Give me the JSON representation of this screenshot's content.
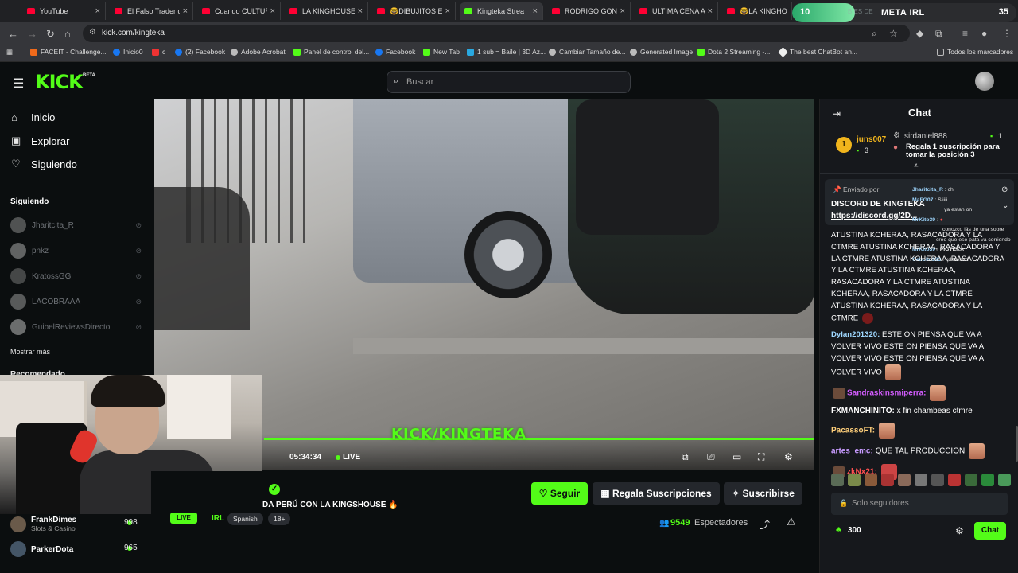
{
  "browser": {
    "tabs": [
      {
        "label": "YouTube",
        "icon": "youtube-icon"
      },
      {
        "label": "El Falso Trader qu",
        "icon": "youtube-icon"
      },
      {
        "label": "Cuando CULTUR",
        "icon": "youtube-icon"
      },
      {
        "label": "LA KINGHOUSE T",
        "icon": "youtube-icon"
      },
      {
        "label": "🤓DIBUJITOS ENT",
        "icon": "youtube-icon"
      },
      {
        "label": "Kingteka Strea",
        "icon": "kick-icon"
      },
      {
        "label": "RODRIGO GONZÁ",
        "icon": "youtube-icon"
      },
      {
        "label": "ULTIMA CENA AN",
        "icon": "youtube-icon"
      },
      {
        "label": "🤓LA KINGHOUS",
        "icon": "youtube-icon"
      }
    ],
    "meta_widget": {
      "left_value": "10",
      "title": "META IRL",
      "right_value": "35",
      "progress": 0.28,
      "bg_text": "BIES DE"
    },
    "url": "kick.com/kingteka",
    "bookmarks": [
      "FACEIT - Challenge...",
      "Inicio0",
      "c",
      "(2) Facebook",
      "Adobe Acrobat",
      "Panel de control del...",
      "Facebook",
      "New Tab",
      "1 sub = Baile | 3D Az...",
      "Cambiar Tamaño de...",
      "Generated Image",
      "Dota 2 Streaming -...",
      "The best ChatBot an..."
    ],
    "bookmarks_all": "Todos los marcadores"
  },
  "kick": {
    "logo": "KICK",
    "beta": "BETA",
    "search_placeholder": "Buscar"
  },
  "sidebar": {
    "nav": [
      {
        "label": "Inicio",
        "icon": "home-icon"
      },
      {
        "label": "Explorar",
        "icon": "explore-icon"
      },
      {
        "label": "Siguiendo",
        "icon": "heart-icon"
      }
    ],
    "heading": "Siguiendo",
    "following": [
      "Jharitcita_R",
      "pnkz",
      "KratossGG",
      "LACOBRAAA",
      "GuibelReviewsDirecto"
    ],
    "show_more": "Mostrar más",
    "recommended": "Recomendado",
    "recommended_items": [
      {
        "name": "FrankDimes",
        "category": "Slots & Casino",
        "viewers": "998"
      },
      {
        "name": "ParkerDota",
        "viewers": "965"
      }
    ]
  },
  "player": {
    "watermark": "KICK/KINGTEKA",
    "time": "05:34:34",
    "live": "LIVE"
  },
  "stream": {
    "title_visible": "DA PERÚ CON LA KINGSHOUSE 🔥",
    "live_badge": "LIVE",
    "category": "IRL",
    "tags": [
      "Spanish",
      "18+"
    ],
    "follow_label": "Seguir",
    "gift_label": "Regala Suscripciones",
    "subscribe_label": "Suscribirse",
    "viewers_count": "9549",
    "viewers_label": "Espectadores"
  },
  "chat": {
    "title": "Chat",
    "leaderboard": {
      "rank": "1",
      "top_user": "juns007",
      "top_count": "3",
      "second_user": "sirdaniel888",
      "second_count": "1",
      "promo": "Regala 1 suscripción para tomar la posición 3"
    },
    "pinned": {
      "by": "Enviado por",
      "title": "DISCORD DE KINGTEKA",
      "link": "https://discord.gg/2D..."
    },
    "overlay_lines": [
      {
        "user": "Jharitcita_R",
        "text": "chi"
      },
      {
        "user": "MaFG07",
        "text": "Siiiii"
      },
      {
        "user": "",
        "text": "ya estan on"
      },
      {
        "user": "MrKito39",
        "text": ""
      },
      {
        "user": "",
        "text": "conozco lás de una sobre"
      },
      {
        "user": "",
        "text": "creo que ese pata va corriendo"
      },
      {
        "user": "MrKito39",
        "text": "PIGTEKA"
      },
      {
        "user": "Cebollo123",
        "text": "xdxdxdxd"
      }
    ],
    "messages": [
      {
        "user": "",
        "text": "ATUSTINA KCHERAA, RASACADORA Y LA CTMRE ATUSTINA KCHERAA, RASACADORA Y LA CTMRE ATUSTINA KCHERAA, RASACADORA Y LA CTMRE ATUSTINA KCHERAA, RASACADORA Y LA CTMRE ATUSTINA KCHERAA, RASACADORA Y LA CTMRE ATUSTINA KCHERAA, RASACADORA Y LA CTMRE",
        "color": "#ffffff"
      },
      {
        "user": "Dylan201320:",
        "text": "ESTE ON PIENSA QUE VA A VOLVER VIVO ESTE ON PIENSA QUE VA A VOLVER VIVO ESTE ON PIENSA QUE VA A VOLVER VIVO",
        "color": "#9fd7ff"
      },
      {
        "user": "Sandraskinsmiperra:",
        "text": "",
        "color": "#d35cff"
      },
      {
        "user": "FXMANCHINITO:",
        "text": "x fin chambeas ctmre",
        "color": "#ffffff"
      },
      {
        "user": "PacassoFT:",
        "text": "",
        "color": "#ffcf7a"
      },
      {
        "user": "artes_emc:",
        "text": "QUE TAL PRODUCCION",
        "color": "#c89bff"
      },
      {
        "user": "zkNx21:",
        "text": "",
        "color": "#ff4f4f"
      }
    ],
    "input_placeholder": "Solo seguidores",
    "points": "300",
    "send_label": "Chat"
  },
  "colors": {
    "accent": "#53fc18",
    "bg": "#0b0e0f",
    "panel": "#16181c"
  }
}
